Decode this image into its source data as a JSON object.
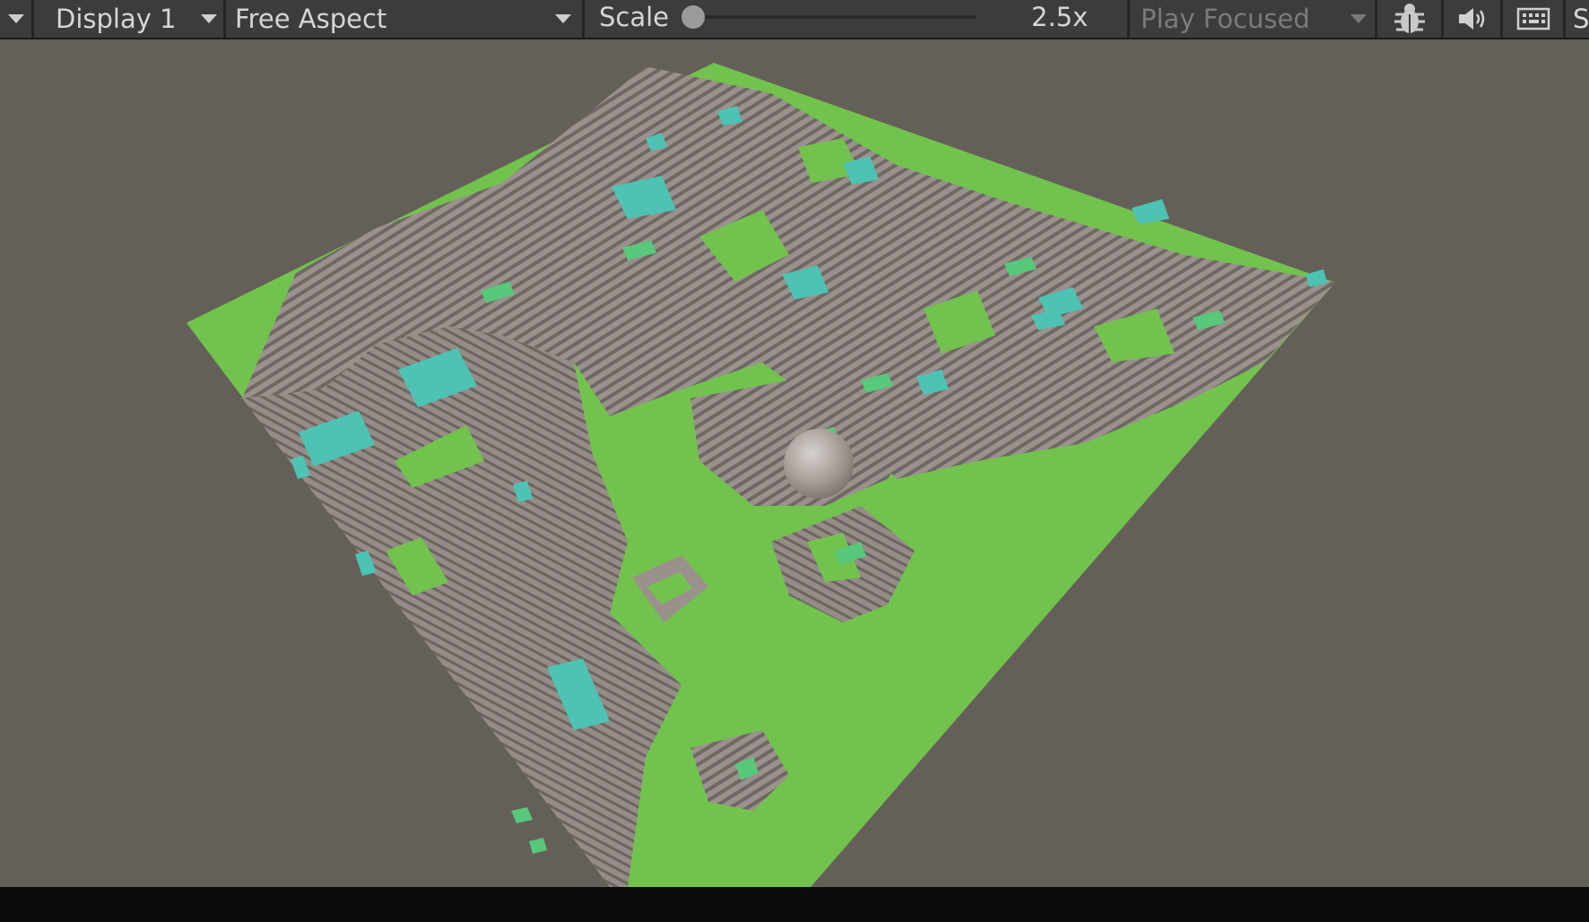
{
  "toolbar": {
    "display_select": "Display 1",
    "aspect_select": "Free Aspect",
    "scale_label": "Scale",
    "scale_value": "2.5x",
    "scale_slider_fraction": 0.0,
    "play_mode_select": "Play Focused",
    "truncated_label": "S",
    "icons": [
      "bug-icon",
      "audio-icon",
      "keyboard-icon"
    ]
  },
  "viewport": {
    "scene": "voxel terrain with grey stone hills, green grass and turquoise voxel patches, grey sphere",
    "colors": {
      "background": "#655f59",
      "grass": "#72c34d",
      "stone": "#9a918c",
      "stone_dark": "#6e6764",
      "water": "#4dc3b3"
    }
  }
}
